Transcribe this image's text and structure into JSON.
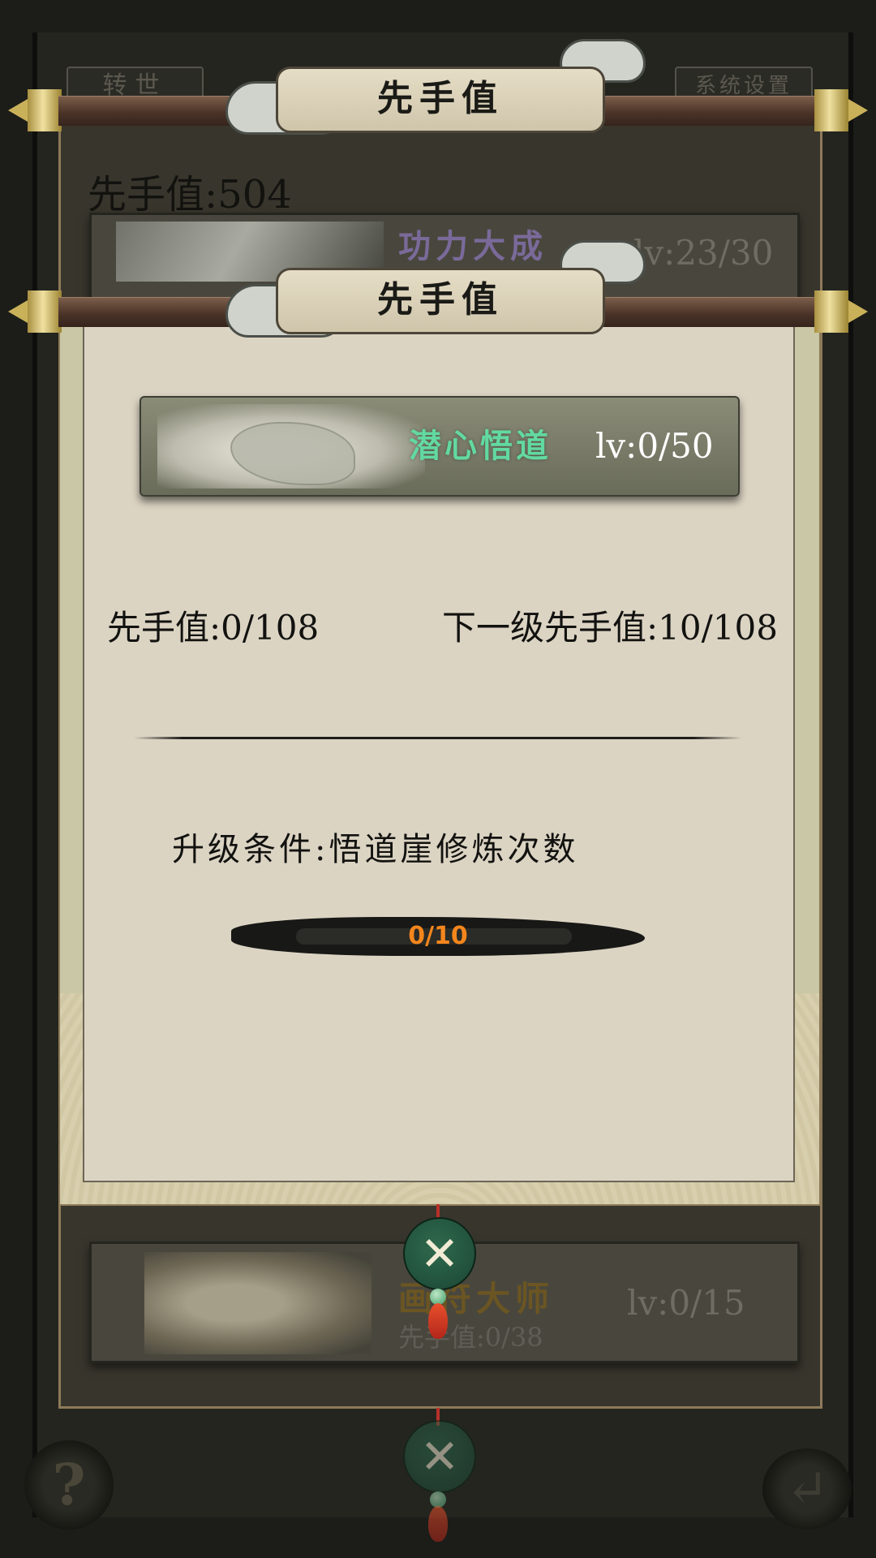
{
  "background": {
    "tabs": [
      {
        "label": "转世"
      },
      {
        "label": "系统设置"
      }
    ],
    "help_label": "?",
    "back_label": "↵"
  },
  "back_panel": {
    "title": "先手值",
    "score_label": "先手值",
    "score_value": "504",
    "cards": [
      {
        "name": "功力大成",
        "lv_label": "lv:",
        "lv_value": "23/30"
      },
      {
        "name": "画符大师",
        "sub_label": "先手值:",
        "sub_value": "0/38",
        "lv_label": "lv:",
        "lv_value": "0/15"
      }
    ]
  },
  "dialog": {
    "title": "先手值",
    "skill_name": "潜心悟道",
    "skill_lv_label": "lv:",
    "skill_lv_value": "0/50",
    "current_label": "先手值",
    "current_value": "0/108",
    "next_label": "下一级先手值",
    "next_value": "10/108",
    "condition_label": "升级条件",
    "condition_value": "悟道崖修炼次数",
    "progress_text": "0/10",
    "progress_current": 0,
    "progress_max": 10
  },
  "close_icon": "crossed-swords-icon",
  "colors": {
    "skill_name": "#62d9a0",
    "progress_text": "#f4861c",
    "button_green": "#2f6a4e",
    "tassel_red": "#b3261a",
    "rod_gold": "#c9b15a"
  }
}
